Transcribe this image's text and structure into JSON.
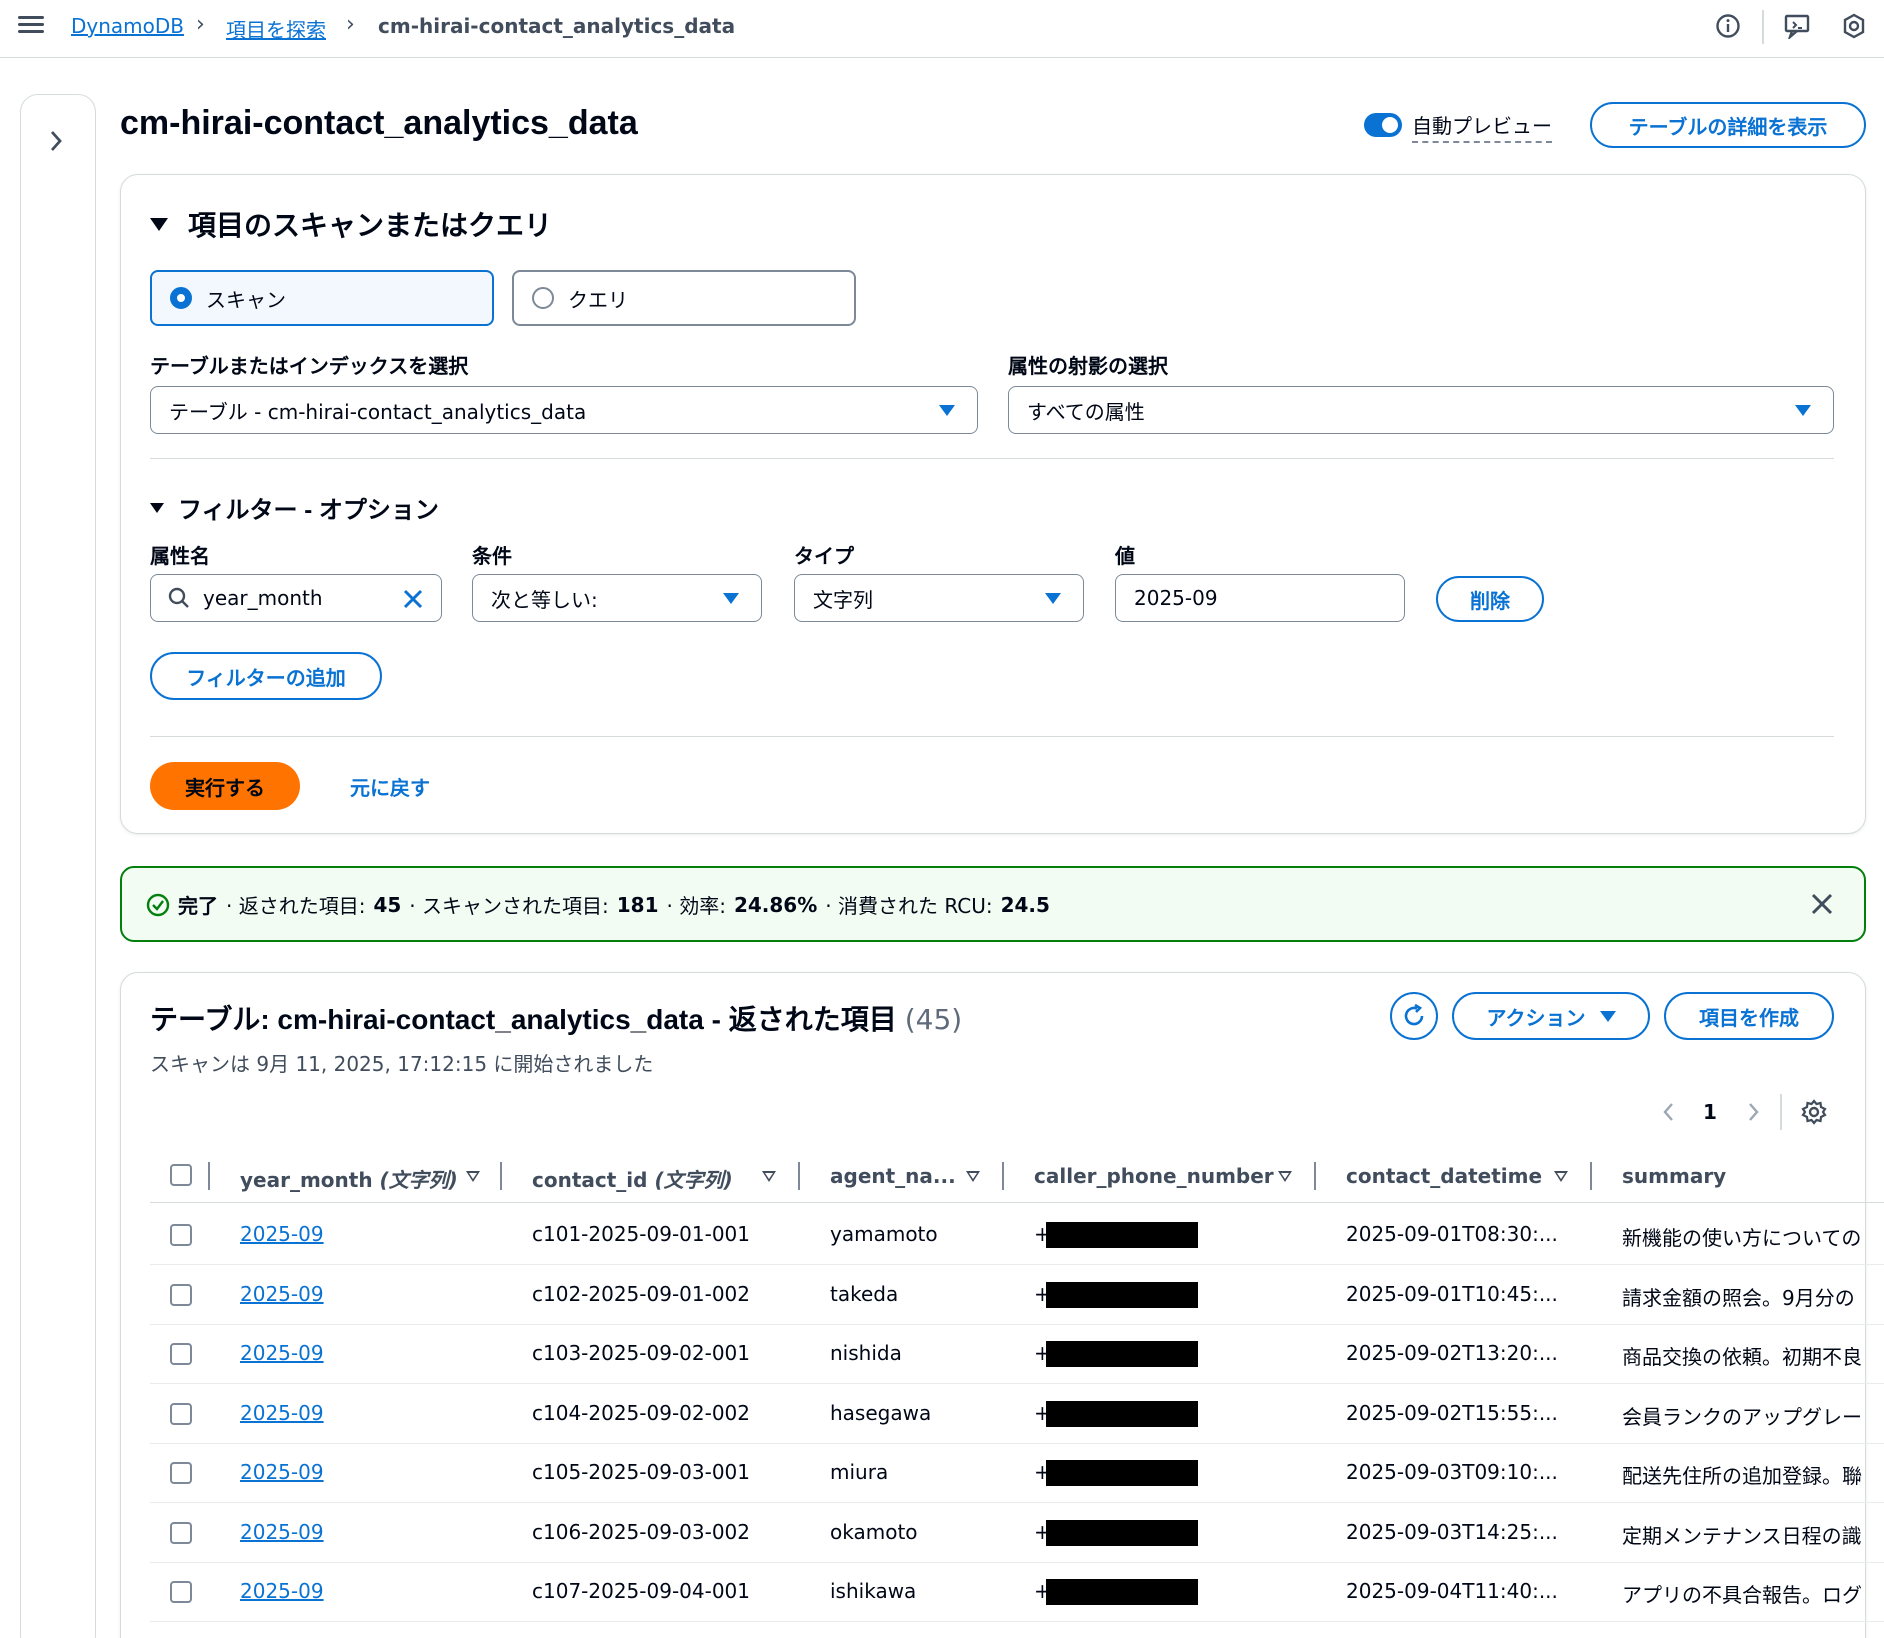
{
  "breadcrumb": {
    "items": [
      "DynamoDB",
      "項目を探索"
    ],
    "current": "cm-hirai-contact_analytics_data"
  },
  "header_icons": [
    "info-icon",
    "feedback-icon",
    "settings-icon"
  ],
  "page": {
    "title": "cm-hirai-contact_analytics_data",
    "auto_preview_label": "自動プレビュー",
    "auto_preview_on": true,
    "view_table_details": "テーブルの詳細を表示"
  },
  "scan_panel": {
    "title": "項目のスキャンまたはクエリ",
    "scan_label": "スキャン",
    "query_label": "クエリ",
    "selected": "scan",
    "table_select_label": "テーブルまたはインデックスを選択",
    "table_select_value": "テーブル - cm-hirai-contact_analytics_data",
    "projection_label": "属性の射影の選択",
    "projection_value": "すべての属性",
    "filter_title": "フィルター - オプション",
    "filter": {
      "attr_label": "属性名",
      "attr_value": "year_month",
      "condition_label": "条件",
      "condition_value": "次と等しい:",
      "type_label": "タイプ",
      "type_value": "文字列",
      "value_label": "値",
      "value_value": "2025-09",
      "remove_label": "削除"
    },
    "add_filter_label": "フィルターの追加",
    "run_label": "実行する",
    "reset_label": "元に戻す"
  },
  "alert": {
    "status": "完了",
    "returned_label": "· 返された項目:",
    "returned_value": "45",
    "scanned_label": "· スキャンされた項目:",
    "scanned_value": "181",
    "efficiency_label": "· 効率:",
    "efficiency_value": "24.86%",
    "rcu_label": "· 消費された RCU:",
    "rcu_value": "24.5"
  },
  "results": {
    "title": "テーブル: cm-hirai-contact_analytics_data - 返された項目",
    "count": "(45)",
    "subtitle": "スキャンは 9月 11, 2025, 17:12:15 に開始されました",
    "actions_label": "アクション",
    "create_label": "項目を作成",
    "page_number": "1",
    "columns": [
      {
        "name": "year_month",
        "type": "(文字列)"
      },
      {
        "name": "contact_id",
        "type": "(文字列)"
      },
      {
        "name": "agent_na...",
        "type": ""
      },
      {
        "name": "caller_phone_number",
        "type": ""
      },
      {
        "name": "contact_datetime",
        "type": ""
      },
      {
        "name": "summary",
        "type": ""
      }
    ],
    "rows": [
      {
        "year_month": "2025-09",
        "contact_id": "c101-2025-09-01-001",
        "agent": "yamamoto",
        "phone": "+",
        "datetime": "2025-09-01T08:30:...",
        "summary": "新機能の使い方についての"
      },
      {
        "year_month": "2025-09",
        "contact_id": "c102-2025-09-01-002",
        "agent": "takeda",
        "phone": "+",
        "datetime": "2025-09-01T10:45:...",
        "summary": "請求金額の照会。9月分の"
      },
      {
        "year_month": "2025-09",
        "contact_id": "c103-2025-09-02-001",
        "agent": "nishida",
        "phone": "+",
        "datetime": "2025-09-02T13:20:...",
        "summary": "商品交換の依頼。初期不良"
      },
      {
        "year_month": "2025-09",
        "contact_id": "c104-2025-09-02-002",
        "agent": "hasegawa",
        "phone": "+",
        "datetime": "2025-09-02T15:55:...",
        "summary": "会員ランクのアップグレー"
      },
      {
        "year_month": "2025-09",
        "contact_id": "c105-2025-09-03-001",
        "agent": "miura",
        "phone": "+",
        "datetime": "2025-09-03T09:10:...",
        "summary": "配送先住所の追加登録。聯"
      },
      {
        "year_month": "2025-09",
        "contact_id": "c106-2025-09-03-002",
        "agent": "okamoto",
        "phone": "+",
        "datetime": "2025-09-03T14:25:...",
        "summary": "定期メンテナンス日程の識"
      },
      {
        "year_month": "2025-09",
        "contact_id": "c107-2025-09-04-001",
        "agent": "ishikawa",
        "phone": "+",
        "datetime": "2025-09-04T11:40:...",
        "summary": "アプリの不具合報告。ログ"
      }
    ]
  },
  "colors": {
    "link": "#0972d3",
    "primary": "#ff7300",
    "success": "#037f0c",
    "border": "#7d8998"
  }
}
